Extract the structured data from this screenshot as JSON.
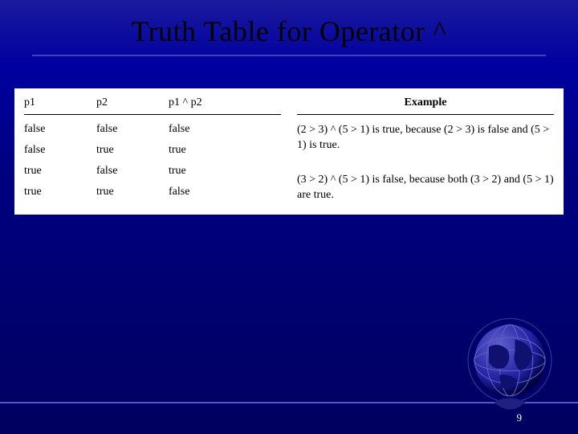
{
  "title": "Truth Table for Operator ^",
  "table": {
    "headers": {
      "c1": "p1",
      "c2": "p2",
      "c3": "p1 ^ p2"
    },
    "rows": [
      {
        "c1": "false",
        "c2": "false",
        "c3": "false"
      },
      {
        "c1": "false",
        "c2": "true",
        "c3": "true"
      },
      {
        "c1": "true",
        "c2": "false",
        "c3": "true"
      },
      {
        "c1": "true",
        "c2": "true",
        "c3": "false"
      }
    ]
  },
  "example": {
    "heading": "Example",
    "items": [
      "(2 > 3) ^ (5 > 1) is true, because (2 > 3) is false and (5 > 1) is true.",
      "(3 > 2) ^ (5 > 1) is false, because both (3 > 2) and (5 > 1) are true."
    ]
  },
  "page_number": "9",
  "chart_data": {
    "type": "table",
    "title": "Truth Table for Operator ^",
    "columns": [
      "p1",
      "p2",
      "p1 ^ p2"
    ],
    "rows": [
      [
        "false",
        "false",
        "false"
      ],
      [
        "false",
        "true",
        "true"
      ],
      [
        "true",
        "false",
        "true"
      ],
      [
        "true",
        "true",
        "false"
      ]
    ]
  }
}
